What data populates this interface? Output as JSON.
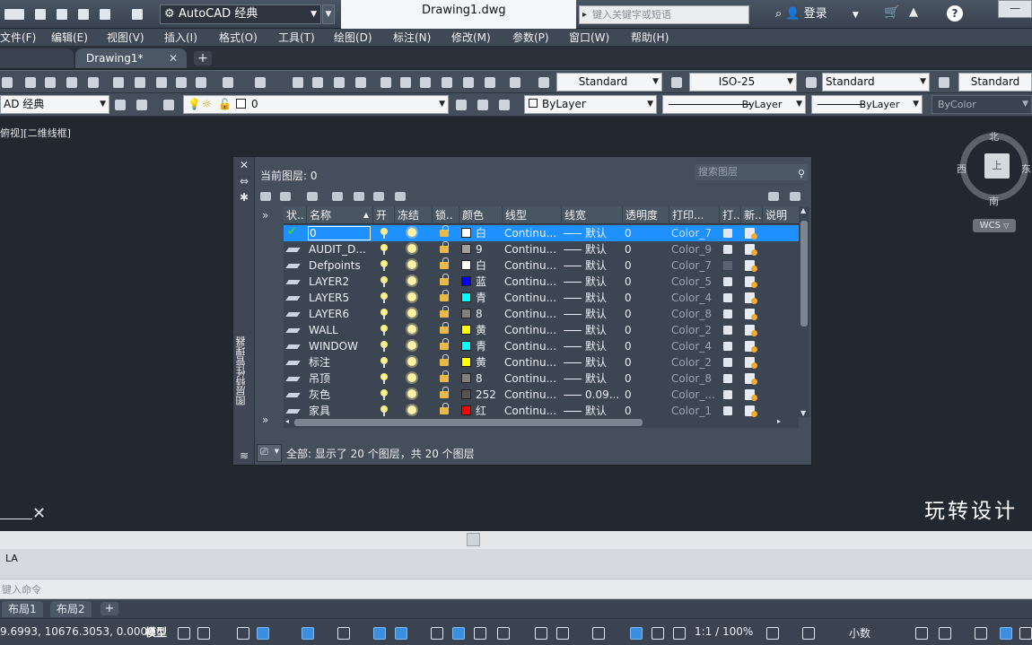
{
  "titlebar": {
    "workspace": "AutoCAD 经典",
    "document_title": "Drawing1.dwg",
    "search_placeholder": "键入关键字或短语",
    "login": "登录"
  },
  "menu": [
    "文件(F)",
    "编辑(E)",
    "视图(V)",
    "插入(I)",
    "格式(O)",
    "工具(T)",
    "绘图(D)",
    "标注(N)",
    "修改(M)",
    "参数(P)",
    "窗口(W)",
    "帮助(H)"
  ],
  "tabs": {
    "active": "Drawing1*"
  },
  "toolbar1": {
    "text_style": "Standard",
    "dim_style": "ISO-25",
    "table_style": "Standard",
    "multileader_style": "Standard"
  },
  "toolbar2": {
    "workspace_short": "AD 经典",
    "layer": "0",
    "color": "ByLayer",
    "linetype": "ByLayer",
    "lineweight": "ByLayer",
    "plotstyle": "ByColor"
  },
  "canvas": {
    "viewport_label": "俯视][二维线框]",
    "compass": {
      "n": "北",
      "s": "南",
      "e": "东",
      "w": "西",
      "top": "上"
    },
    "wcs": "WCS",
    "watermark": "玩转设计"
  },
  "layer_palette": {
    "vertical_title": "图层特性管理器",
    "current_layer": "当前图层: 0",
    "search_placeholder": "搜索图层",
    "status_text": "全部: 显示了 20 个图层，共 20 个图层",
    "columns": [
      "状..",
      "名称",
      "开",
      "冻结",
      "锁..",
      "颜色",
      "线型",
      "线宽",
      "透明度",
      "打印...",
      "打..",
      "新..",
      "说明"
    ],
    "rows": [
      {
        "name": "0",
        "color_name": "白",
        "color_hex": "#ffffff",
        "linetype": "Continu...",
        "lineweight": "默认",
        "transparency": "0",
        "plot_style": "Color_7",
        "current": true,
        "plot": true
      },
      {
        "name": "AUDIT_D...",
        "color_name": "9",
        "color_hex": "#a0a0a0",
        "linetype": "Continu...",
        "lineweight": "默认",
        "transparency": "0",
        "plot_style": "Color_9",
        "current": false,
        "plot": true
      },
      {
        "name": "Defpoints",
        "color_name": "白",
        "color_hex": "#ffffff",
        "linetype": "Continu...",
        "lineweight": "默认",
        "transparency": "0",
        "plot_style": "Color_7",
        "current": false,
        "plot": false
      },
      {
        "name": "LAYER2",
        "color_name": "蓝",
        "color_hex": "#0000ff",
        "linetype": "Continu...",
        "lineweight": "默认",
        "transparency": "0",
        "plot_style": "Color_5",
        "current": false,
        "plot": true
      },
      {
        "name": "LAYER5",
        "color_name": "青",
        "color_hex": "#00ffff",
        "linetype": "Continu...",
        "lineweight": "默认",
        "transparency": "0",
        "plot_style": "Color_4",
        "current": false,
        "plot": true
      },
      {
        "name": "LAYER6",
        "color_name": "8",
        "color_hex": "#808080",
        "linetype": "Continu...",
        "lineweight": "默认",
        "transparency": "0",
        "plot_style": "Color_8",
        "current": false,
        "plot": true
      },
      {
        "name": "WALL",
        "color_name": "黄",
        "color_hex": "#ffff00",
        "linetype": "Continu...",
        "lineweight": "默认",
        "transparency": "0",
        "plot_style": "Color_2",
        "current": false,
        "plot": true
      },
      {
        "name": "WINDOW",
        "color_name": "青",
        "color_hex": "#00ffff",
        "linetype": "Continu...",
        "lineweight": "默认",
        "transparency": "0",
        "plot_style": "Color_4",
        "current": false,
        "plot": true
      },
      {
        "name": "标注",
        "color_name": "黄",
        "color_hex": "#ffff00",
        "linetype": "Continu...",
        "lineweight": "默认",
        "transparency": "0",
        "plot_style": "Color_2",
        "current": false,
        "plot": true
      },
      {
        "name": "吊顶",
        "color_name": "8",
        "color_hex": "#808080",
        "linetype": "Continu...",
        "lineweight": "默认",
        "transparency": "0",
        "plot_style": "Color_8",
        "current": false,
        "plot": true
      },
      {
        "name": "灰色",
        "color_name": "252",
        "color_hex": "#555555",
        "linetype": "Continu...",
        "lineweight": "0.09...",
        "transparency": "0",
        "plot_style": "Color_...",
        "current": false,
        "plot": true
      },
      {
        "name": "家具",
        "color_name": "红",
        "color_hex": "#ff0000",
        "linetype": "Continu...",
        "lineweight": "默认",
        "transparency": "0",
        "plot_style": "Color_1",
        "current": false,
        "plot": true
      }
    ]
  },
  "command": {
    "history": "LA",
    "placeholder": "键入命令"
  },
  "layout_tabs": [
    "布局1",
    "布局2"
  ],
  "statusbar": {
    "coords": "9.6993, 10676.3053, 0.0000",
    "model": "模型",
    "scale": "1:1 / 100%",
    "units": "小数"
  },
  "colors": {
    "selection": "#1e90ff",
    "palette_bg": "#454f5b",
    "canvas_bg": "#212830"
  }
}
